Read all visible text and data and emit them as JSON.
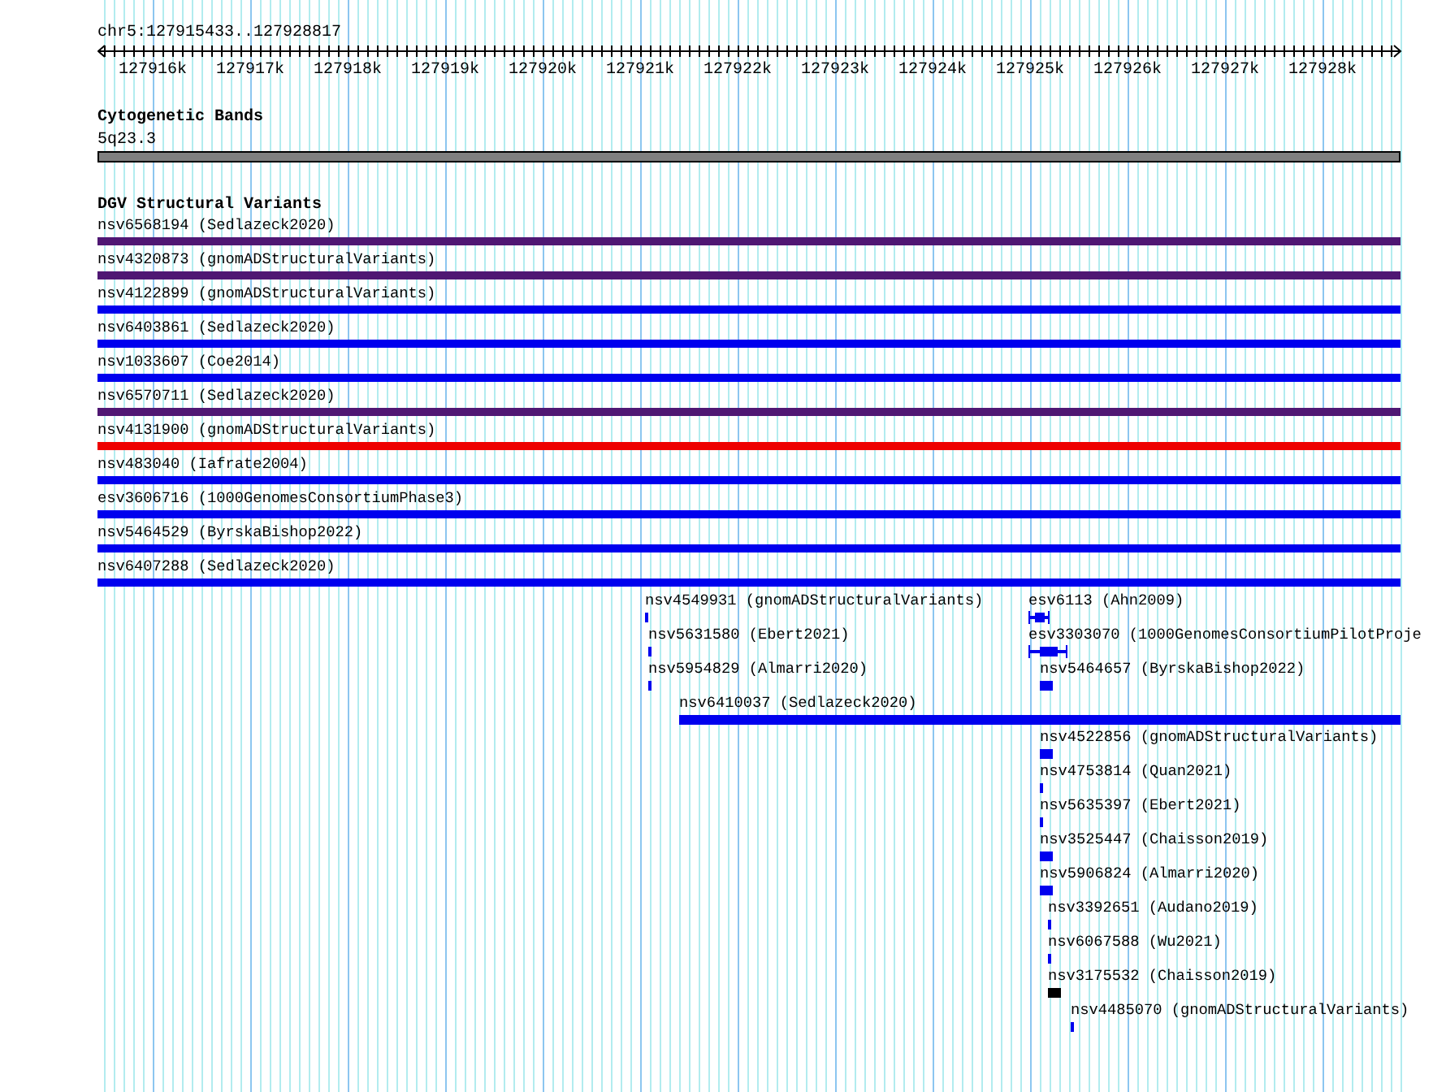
{
  "location": "chr5:127915433..127928817",
  "ruler": {
    "labels": [
      "127916k",
      "127917k",
      "127918k",
      "127919k",
      "127920k",
      "127921k",
      "127922k",
      "127923k",
      "127924k",
      "127925k",
      "127926k",
      "127927k",
      "127928k"
    ]
  },
  "cytoband_track": {
    "title": "Cytogenetic Bands",
    "band": "5q23.3"
  },
  "dgv_track": {
    "title": "DGV Structural Variants",
    "lanes": [
      {
        "features": [
          {
            "label": "nsv6568194 (Sedlazeck2020)",
            "color": "#4f1773",
            "kind": "bar"
          }
        ]
      },
      {
        "features": [
          {
            "label": "nsv4320873 (gnomADStructuralVariants)",
            "color": "#4f1773",
            "kind": "bar"
          }
        ]
      },
      {
        "features": [
          {
            "label": "nsv4122899 (gnomADStructuralVariants)",
            "color": "#0000ee",
            "kind": "bar"
          }
        ]
      },
      {
        "features": [
          {
            "label": "nsv6403861 (Sedlazeck2020)",
            "color": "#0000ee",
            "kind": "bar"
          }
        ]
      },
      {
        "features": [
          {
            "label": "nsv1033607 (Coe2014)",
            "color": "#0000ee",
            "kind": "bar"
          }
        ]
      },
      {
        "features": [
          {
            "label": "nsv6570711 (Sedlazeck2020)",
            "color": "#4f1773",
            "kind": "bar"
          }
        ]
      },
      {
        "features": [
          {
            "label": "nsv4131900 (gnomADStructuralVariants)",
            "color": "#ee0000",
            "kind": "bar"
          }
        ]
      },
      {
        "features": [
          {
            "label": "nsv483040 (Iafrate2004)",
            "color": "#0000ee",
            "kind": "bar"
          }
        ]
      },
      {
        "features": [
          {
            "label": "esv3606716 (1000GenomesConsortiumPhase3)",
            "color": "#0000ee",
            "kind": "bar"
          }
        ]
      },
      {
        "features": [
          {
            "label": "nsv5464529 (ByrskaBishop2022)",
            "color": "#0000ee",
            "kind": "bar"
          }
        ]
      },
      {
        "features": [
          {
            "label": "nsv6407288 (Sedlazeck2020)",
            "color": "#0000ee",
            "kind": "bar"
          }
        ]
      },
      {
        "features": [
          {
            "label": "nsv4549931 (gnomADStructuralVariants)",
            "color": "#0000ee",
            "kind": "bar"
          },
          {
            "label": "esv6113 (Ahn2009)",
            "color": "#0000ee",
            "kind": "gapped"
          }
        ]
      },
      {
        "features": [
          {
            "label": "nsv5631580 (Ebert2021)",
            "color": "#0000ee",
            "kind": "bar"
          },
          {
            "label": "esv3303070 (1000GenomesConsortiumPilotProje",
            "color": "#0000ee",
            "kind": "gapped"
          }
        ]
      },
      {
        "features": [
          {
            "label": "nsv5954829 (Almarri2020)",
            "color": "#0000ee",
            "kind": "bar"
          },
          {
            "label": "nsv5464657 (ByrskaBishop2022)",
            "color": "#0000ee",
            "kind": "bar"
          }
        ]
      },
      {
        "features": [
          {
            "label": "nsv6410037 (Sedlazeck2020)",
            "color": "#0000ee",
            "kind": "bar"
          }
        ]
      },
      {
        "features": [
          {
            "label": "nsv4522856 (gnomADStructuralVariants)",
            "color": "#0000ee",
            "kind": "bar"
          }
        ]
      },
      {
        "features": [
          {
            "label": "nsv4753814 (Quan2021)",
            "color": "#0000ee",
            "kind": "bar"
          }
        ]
      },
      {
        "features": [
          {
            "label": "nsv5635397 (Ebert2021)",
            "color": "#0000ee",
            "kind": "bar"
          }
        ]
      },
      {
        "features": [
          {
            "label": "nsv3525447 (Chaisson2019)",
            "color": "#0000ee",
            "kind": "bar"
          }
        ]
      },
      {
        "features": [
          {
            "label": "nsv5906824 (Almarri2020)",
            "color": "#0000ee",
            "kind": "bar"
          }
        ]
      },
      {
        "features": [
          {
            "label": "nsv3392651 (Audano2019)",
            "color": "#0000ee",
            "kind": "bar"
          }
        ]
      },
      {
        "features": [
          {
            "label": "nsv6067588 (Wu2021)",
            "color": "#0000ee",
            "kind": "bar"
          }
        ]
      },
      {
        "features": [
          {
            "label": "nsv3175532 (Chaisson2019)",
            "color": "#000000",
            "kind": "bar"
          }
        ]
      },
      {
        "features": [
          {
            "label": "nsv4485070 (gnomADStructuralVariants)",
            "color": "#0000ee",
            "kind": "bar"
          }
        ]
      }
    ]
  }
}
